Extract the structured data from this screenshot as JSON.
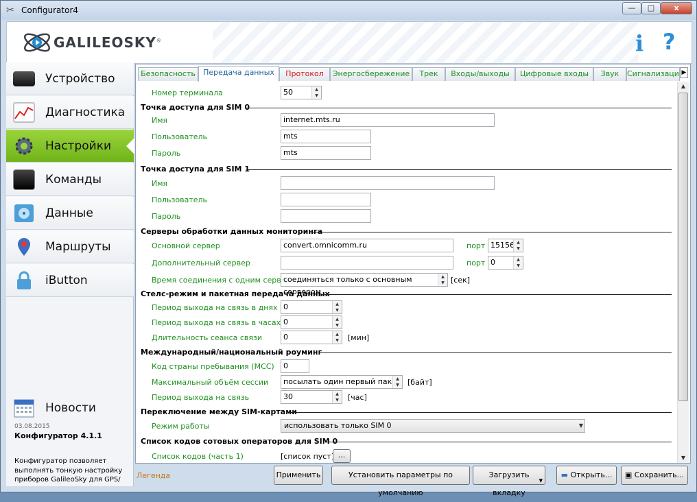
{
  "window": {
    "title": "Configurator4",
    "min": "—",
    "max": "□",
    "close": "x"
  },
  "header": {
    "logo": "GALILEOSKY",
    "reg": "®",
    "info_icon": "i",
    "help_icon": "?"
  },
  "sidebar": {
    "items": [
      {
        "label": "Устройство",
        "icon": "device-icon"
      },
      {
        "label": "Диагностика",
        "icon": "chart-icon"
      },
      {
        "label": "Настройки",
        "icon": "gear-icon",
        "active": true
      },
      {
        "label": "Команды",
        "icon": "terminal-icon"
      },
      {
        "label": "Данные",
        "icon": "disk-icon"
      },
      {
        "label": "Маршруты",
        "icon": "pin-icon"
      },
      {
        "label": "iButton",
        "icon": "lock-icon"
      }
    ],
    "news": "Новости",
    "date": "03.08.2015",
    "version": "Конфигуратор 4.1.1",
    "desc1": "Конфигуратор позволяет",
    "desc2": "выполнять тонкую настройку",
    "desc3": "приборов GalileoSky для GPS/"
  },
  "tabs": [
    "Безопасность",
    "Передача данных",
    "Протокол",
    "Энергосбережение",
    "Трек",
    "Входы/выходы",
    "Цифровые входы",
    "Звук",
    "Сигнализация"
  ],
  "form": {
    "terminal_label": "Номер терминала",
    "terminal_value": "50",
    "sim0_title": "Точка доступа для SIM 0",
    "sim0_name_label": "Имя",
    "sim0_name": "internet.mts.ru",
    "sim0_user_label": "Пользователь",
    "sim0_user": "mts",
    "sim0_pass_label": "Пароль",
    "sim0_pass": "mts",
    "sim1_title": "Точка доступа для SIM 1",
    "sim1_name_label": "Имя",
    "sim1_user_label": "Пользователь",
    "sim1_pass_label": "Пароль",
    "servers_title": "Серверы обработки данных мониторинга",
    "main_server_label": "Основной сервер",
    "main_server": "convert.omnicomm.ru",
    "port_label": "порт",
    "main_port": "15156",
    "add_server_label": "Дополнительный сервер",
    "add_port": "0",
    "conn_time_label": "Время соединения с одним сервером",
    "conn_time": "соединяться только с основным сервером",
    "conn_unit": "[сек]",
    "stealth_title": "Стелс-режим и пакетная передача данных",
    "period_days_label": "Период выхода на связь в днях",
    "period_days": "0",
    "period_hours_label": "Период выхода на связь в часах",
    "period_hours": "0",
    "session_label": "Длительность сеанса связи",
    "session": "0",
    "session_unit": "[мин]",
    "roaming_title": "Международный/национальный роуминг",
    "mcc_label": "Код страны пребывания (MCC)",
    "mcc": "0",
    "max_session_label": "Максимальный объём сессии",
    "max_session": "посылать один первый пакет",
    "max_session_unit": "[байт]",
    "period_label": "Период выхода на связь",
    "period": "30",
    "period_unit": "[час]",
    "switch_title": "Переключение между SIM-картами",
    "mode_label": "Режим работы",
    "mode": "использовать только SIM 0",
    "codes_title": "Список кодов сотовых операторов для SIM 0",
    "codes_label": "Список кодов (часть 1)",
    "codes_value": "[список пуст]",
    "codes_btn": "..."
  },
  "bottom": {
    "legend": "Легенда",
    "apply": "Применить",
    "defaults": "Установить параметры по умолчанию",
    "load_tab": "Загрузить вкладку",
    "open": "Открыть...",
    "save": "Сохранить..."
  }
}
